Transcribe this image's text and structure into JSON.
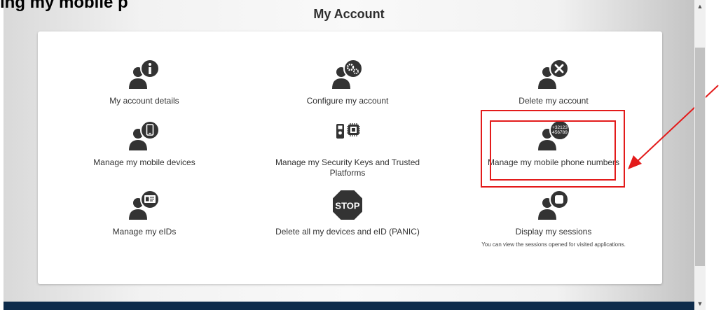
{
  "overlay_text": "ing my mobile p",
  "page_title": "My Account",
  "tiles": [
    {
      "label": "My account details",
      "icon": "user-info-icon"
    },
    {
      "label": "Configure my account",
      "icon": "user-gears-icon"
    },
    {
      "label": "Delete my account",
      "icon": "user-x-icon"
    },
    {
      "label": "Manage my mobile devices",
      "icon": "user-mobile-icon"
    },
    {
      "label": "Manage my Security Keys and Trusted Platforms",
      "icon": "security-key-chip-icon"
    },
    {
      "label": "Manage my mobile phone numbers",
      "icon": "user-phone-numbers-icon",
      "badge_line1": "+32123",
      "badge_line2": "456789"
    },
    {
      "label": "Manage my eIDs",
      "icon": "user-eid-card-icon"
    },
    {
      "label": "Delete all my devices and eID (PANIC)",
      "icon": "stop-sign-icon",
      "stop_text": "STOP"
    },
    {
      "label": "Display my sessions",
      "icon": "user-session-icon",
      "description": "You can view the sessions opened for visited applications."
    }
  ],
  "scrollbar": {
    "up": "▲",
    "down": "▼"
  },
  "colors": {
    "icon": "#333333",
    "highlight": "#e31b1b",
    "footer": "#0d2b4b",
    "stop": "#333333"
  }
}
